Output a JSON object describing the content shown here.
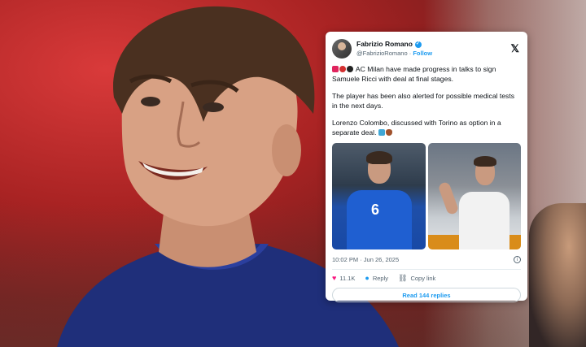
{
  "tweet": {
    "author_name": "Fabrizio Romano",
    "author_handle": "@FabrizioRomano",
    "follow_label": "Follow",
    "paragraphs": [
      "AC Milan have made progress in talks to sign Samuele Ricci with deal at final stages.",
      "The player has been also alerted for possible medical tests in the next days.",
      "Lorenzo Colombo, discussed with Torino as option in a separate deal."
    ],
    "jersey_number": "6",
    "timestamp": "10:02 PM · Jun 26, 2025",
    "likes": "11.1K",
    "reply_label": "Reply",
    "copy_link_label": "Copy link",
    "read_replies_label": "Read 144 replies"
  },
  "icons": [
    "x-logo-icon",
    "verified-icon",
    "info-icon",
    "heart-icon",
    "reply-icon",
    "link-icon"
  ],
  "colors": {
    "accent": "#1d9bf0",
    "like": "#f91880",
    "background_red": "#a92323",
    "jersey_blue": "#1f3f9e"
  }
}
